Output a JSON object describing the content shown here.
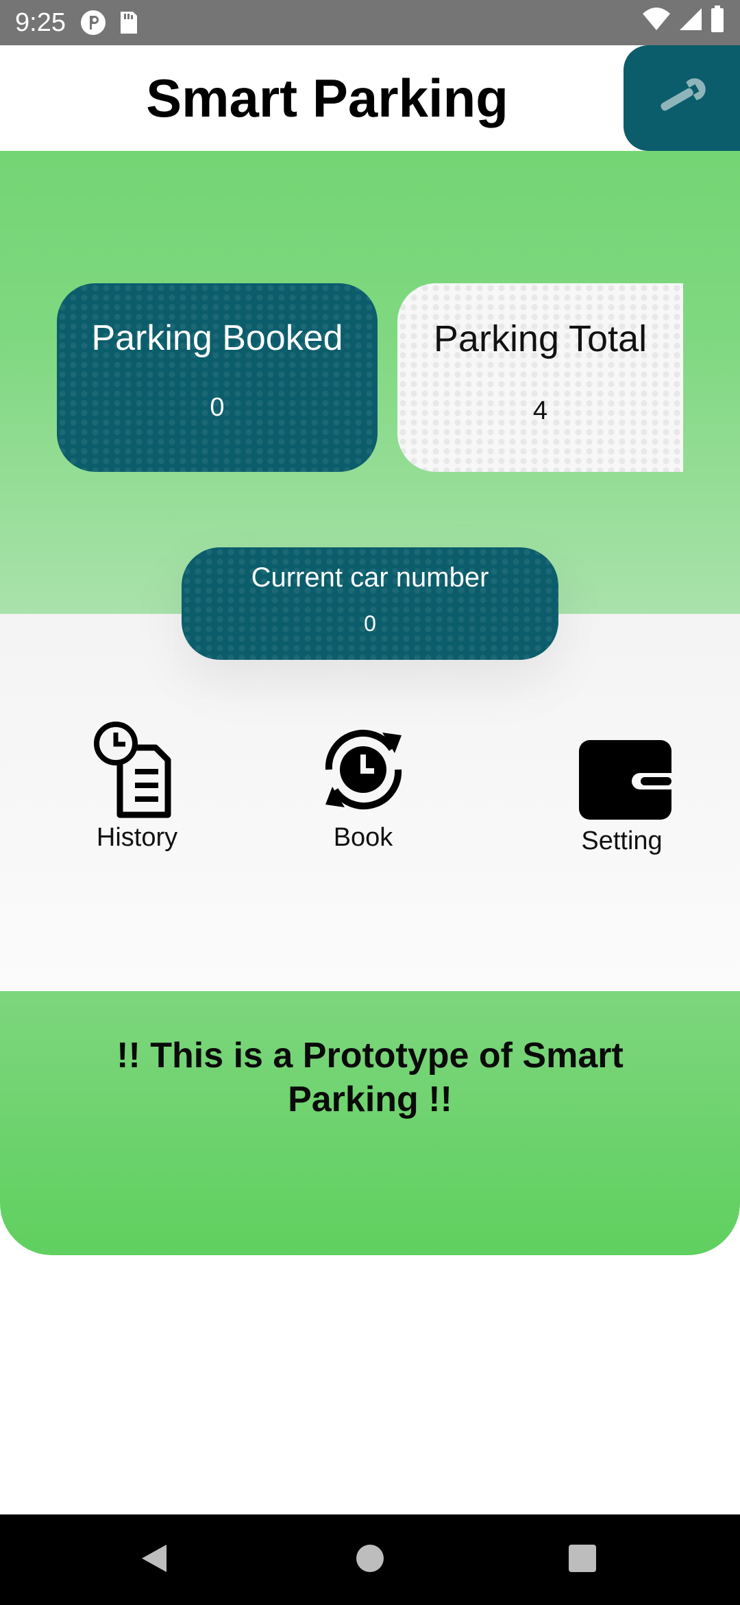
{
  "status_bar": {
    "time": "9:25",
    "icons_left": [
      "p-icon",
      "sd-card-icon"
    ],
    "icons_right": [
      "wifi-icon",
      "signal-icon",
      "battery-icon"
    ]
  },
  "app_bar": {
    "title": "Smart Parking",
    "action_icon": "wrench-icon"
  },
  "stats": {
    "booked": {
      "label": "Parking Booked",
      "value": "0"
    },
    "total": {
      "label": "Parking Total",
      "value": "4"
    },
    "current": {
      "label": "Current car number",
      "value": "0"
    }
  },
  "menu": {
    "history": {
      "label": "History",
      "icon": "history-icon"
    },
    "book": {
      "label": "Book",
      "icon": "book-clock-icon"
    },
    "setting": {
      "label": "Setting",
      "icon": "wallet-icon"
    }
  },
  "banner": {
    "line1": "!! This is a Prototype of Smart",
    "line2": "Parking !!"
  },
  "nav": [
    "back-icon",
    "home-icon",
    "recents-icon"
  ],
  "colors": {
    "teal": "#0b5d6b",
    "green": "#74d574",
    "status_bar": "#757575"
  }
}
